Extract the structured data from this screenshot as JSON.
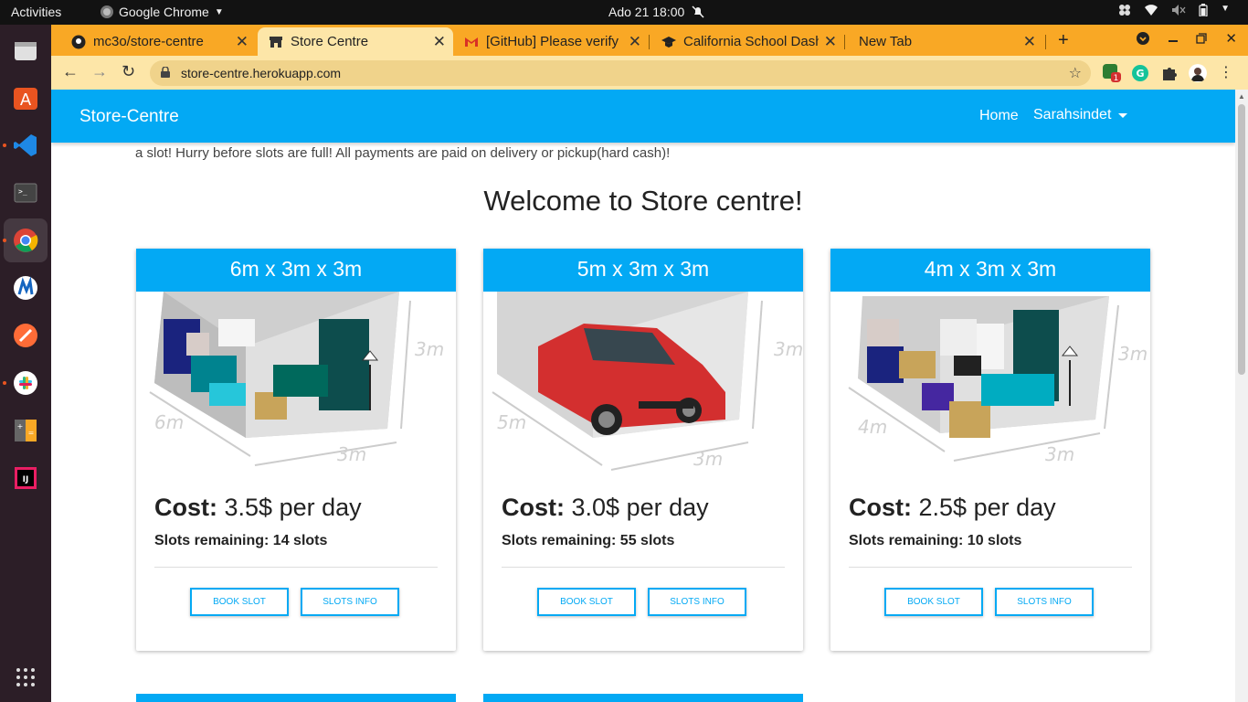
{
  "os": {
    "activities": "Activities",
    "app_name": "Google Chrome",
    "clock": "Ado 21  18:00"
  },
  "browser": {
    "tabs": [
      {
        "title": "mc3o/store-centre",
        "icon": "github-icon"
      },
      {
        "title": "Store Centre",
        "icon": "store-icon"
      },
      {
        "title": "[GitHub] Please verify",
        "icon": "gmail-icon"
      },
      {
        "title": "California School Dash",
        "icon": "school-icon"
      },
      {
        "title": "New Tab",
        "icon": ""
      }
    ],
    "url": "store-centre.herokuapp.com"
  },
  "navbar": {
    "brand": "Store-Centre",
    "home": "Home",
    "user": "Sarahsindet"
  },
  "page": {
    "marquee": "a slot! Hurry before slots are full! All payments are paid on delivery or pickup(hard cash)!",
    "welcome": "Welcome to Store centre!"
  },
  "cards": [
    {
      "size": "6m x 3m x 3m",
      "cost_label": "Cost:",
      "cost": "3.5$ per day",
      "slots": "Slots remaining: 14 slots",
      "book": "BOOK SLOT",
      "info": "SLOTS INFO",
      "depth_label": "6m",
      "width_label": "3m",
      "height_label": "3m"
    },
    {
      "size": "5m x 3m x 3m",
      "cost_label": "Cost:",
      "cost": "3.0$ per day",
      "slots": "Slots remaining: 55 slots",
      "book": "BOOK SLOT",
      "info": "SLOTS INFO",
      "depth_label": "5m",
      "width_label": "3m",
      "height_label": "3m"
    },
    {
      "size": "4m x 3m x 3m",
      "cost_label": "Cost:",
      "cost": "2.5$ per day",
      "slots": "Slots remaining: 10 slots",
      "book": "BOOK SLOT",
      "info": "SLOTS INFO",
      "depth_label": "4m",
      "width_label": "3m",
      "height_label": "3m"
    }
  ],
  "colors": {
    "primary": "#03a9f4",
    "tabstrip": "#f9a825",
    "toolbar": "#fde6a8"
  }
}
